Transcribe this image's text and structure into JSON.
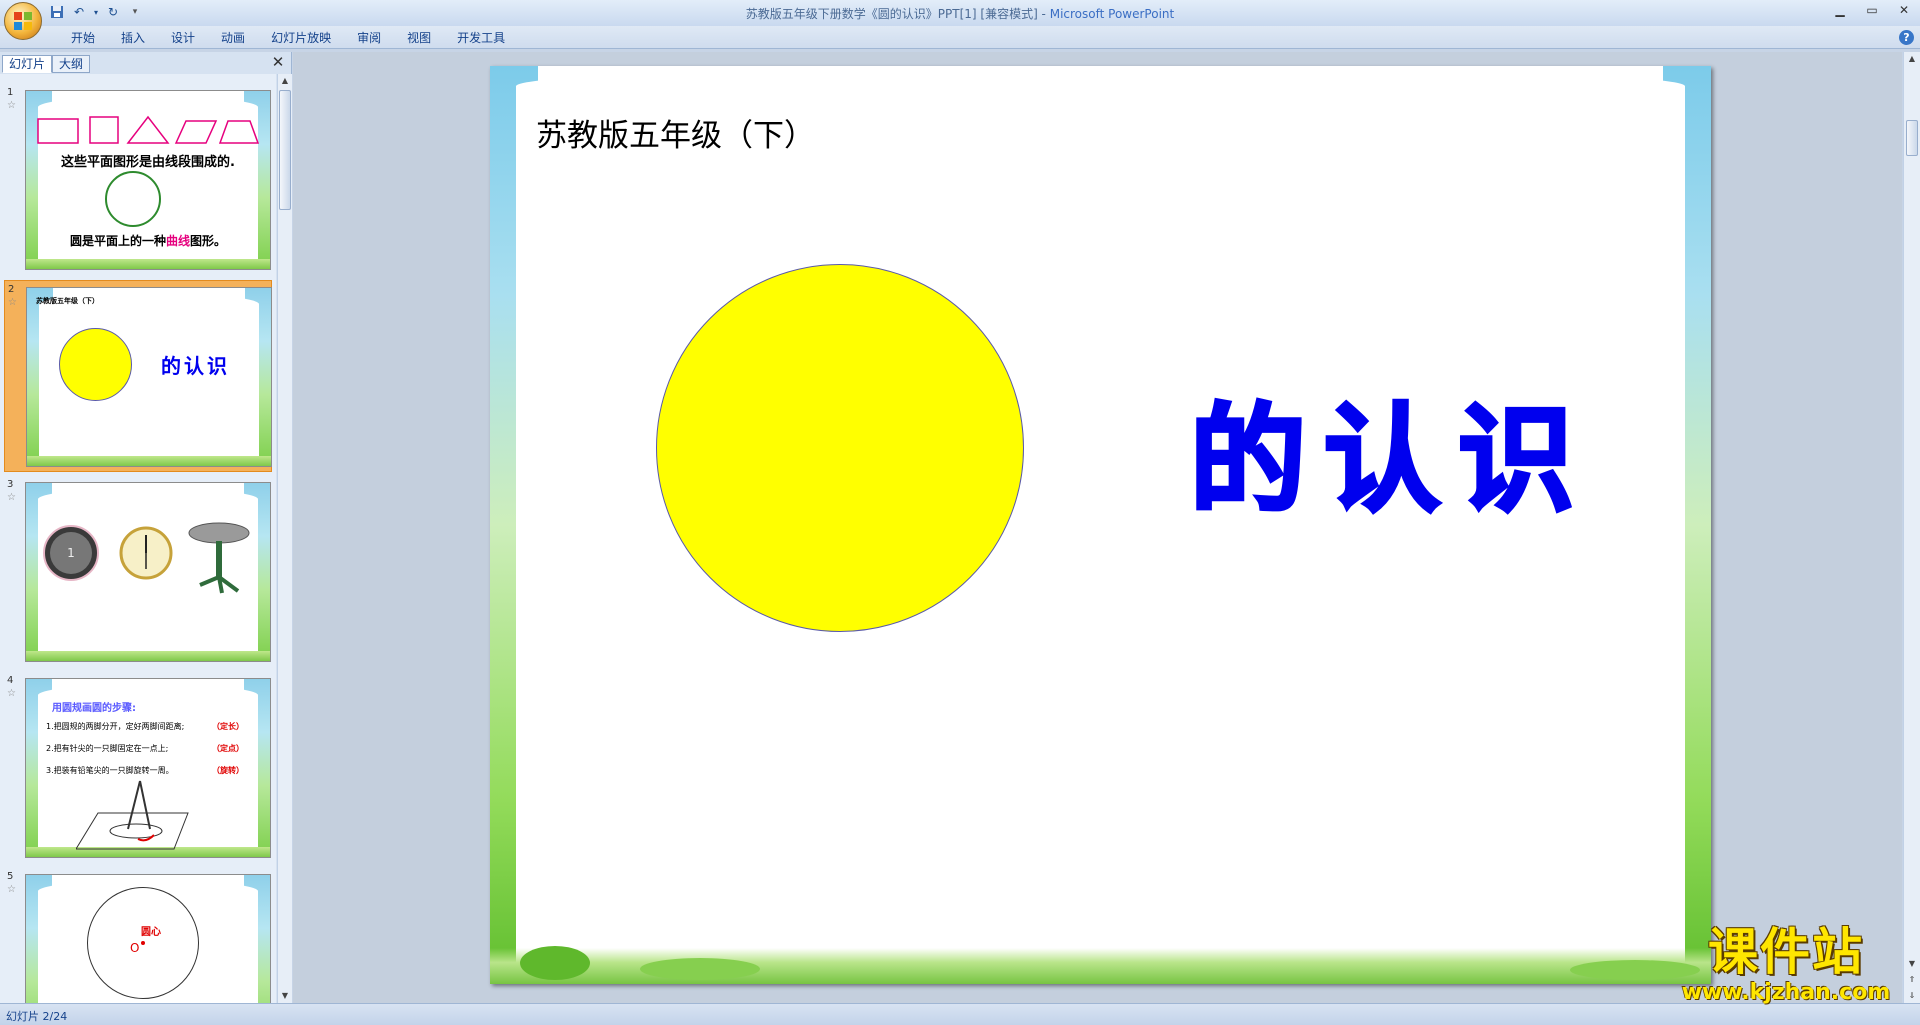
{
  "window": {
    "title_prefix": "苏教版五年级下册数学《圆的认识》PPT[1] [兼容模式] - ",
    "title_app": "Microsoft PowerPoint"
  },
  "ribbon": {
    "tabs": [
      "开始",
      "插入",
      "设计",
      "动画",
      "幻灯片放映",
      "审阅",
      "视图",
      "开发工具"
    ]
  },
  "left_pane": {
    "tabs": [
      "幻灯片",
      "大纲"
    ],
    "close": "✕"
  },
  "thumbnails": [
    {
      "num": "1",
      "line1": "这些平面图形是由线段围成的.",
      "line2_a": "圆是平面上的一种",
      "line2_b": "曲线",
      "line2_c": "图形。"
    },
    {
      "num": "2",
      "subtitle": "苏教版五年级（下）",
      "heading": "的认识"
    },
    {
      "num": "3"
    },
    {
      "num": "4",
      "title": "用圆规画圆的步骤:",
      "steps": [
        {
          "text": "1.把圆规的两脚分开，定好两脚间距离;",
          "tag": "（定长）"
        },
        {
          "text": "2.把有针尖的一只脚固定在一点上;",
          "tag": "（定点）"
        },
        {
          "text": "3.把装有铅笔尖的一只脚旋转一周。",
          "tag": "（旋转）"
        }
      ]
    },
    {
      "num": "5",
      "center_label": "圆心",
      "point": "O"
    }
  ],
  "slide": {
    "subtitle": "苏教版五年级（下）",
    "heading": "的认识"
  },
  "status": {
    "text": "幻灯片 2/24"
  },
  "watermark": {
    "big": "课件站",
    "small": "www.kjzhan.com"
  },
  "colors": {
    "circle_fill": "#ffff00",
    "heading": "#0000ee",
    "accent_pink": "#e6007e",
    "thumb_selected": "#f4b15a"
  },
  "icons": [
    "office-button-icon",
    "save-icon",
    "undo-icon",
    "redo-icon",
    "help-icon",
    "close-icon"
  ]
}
